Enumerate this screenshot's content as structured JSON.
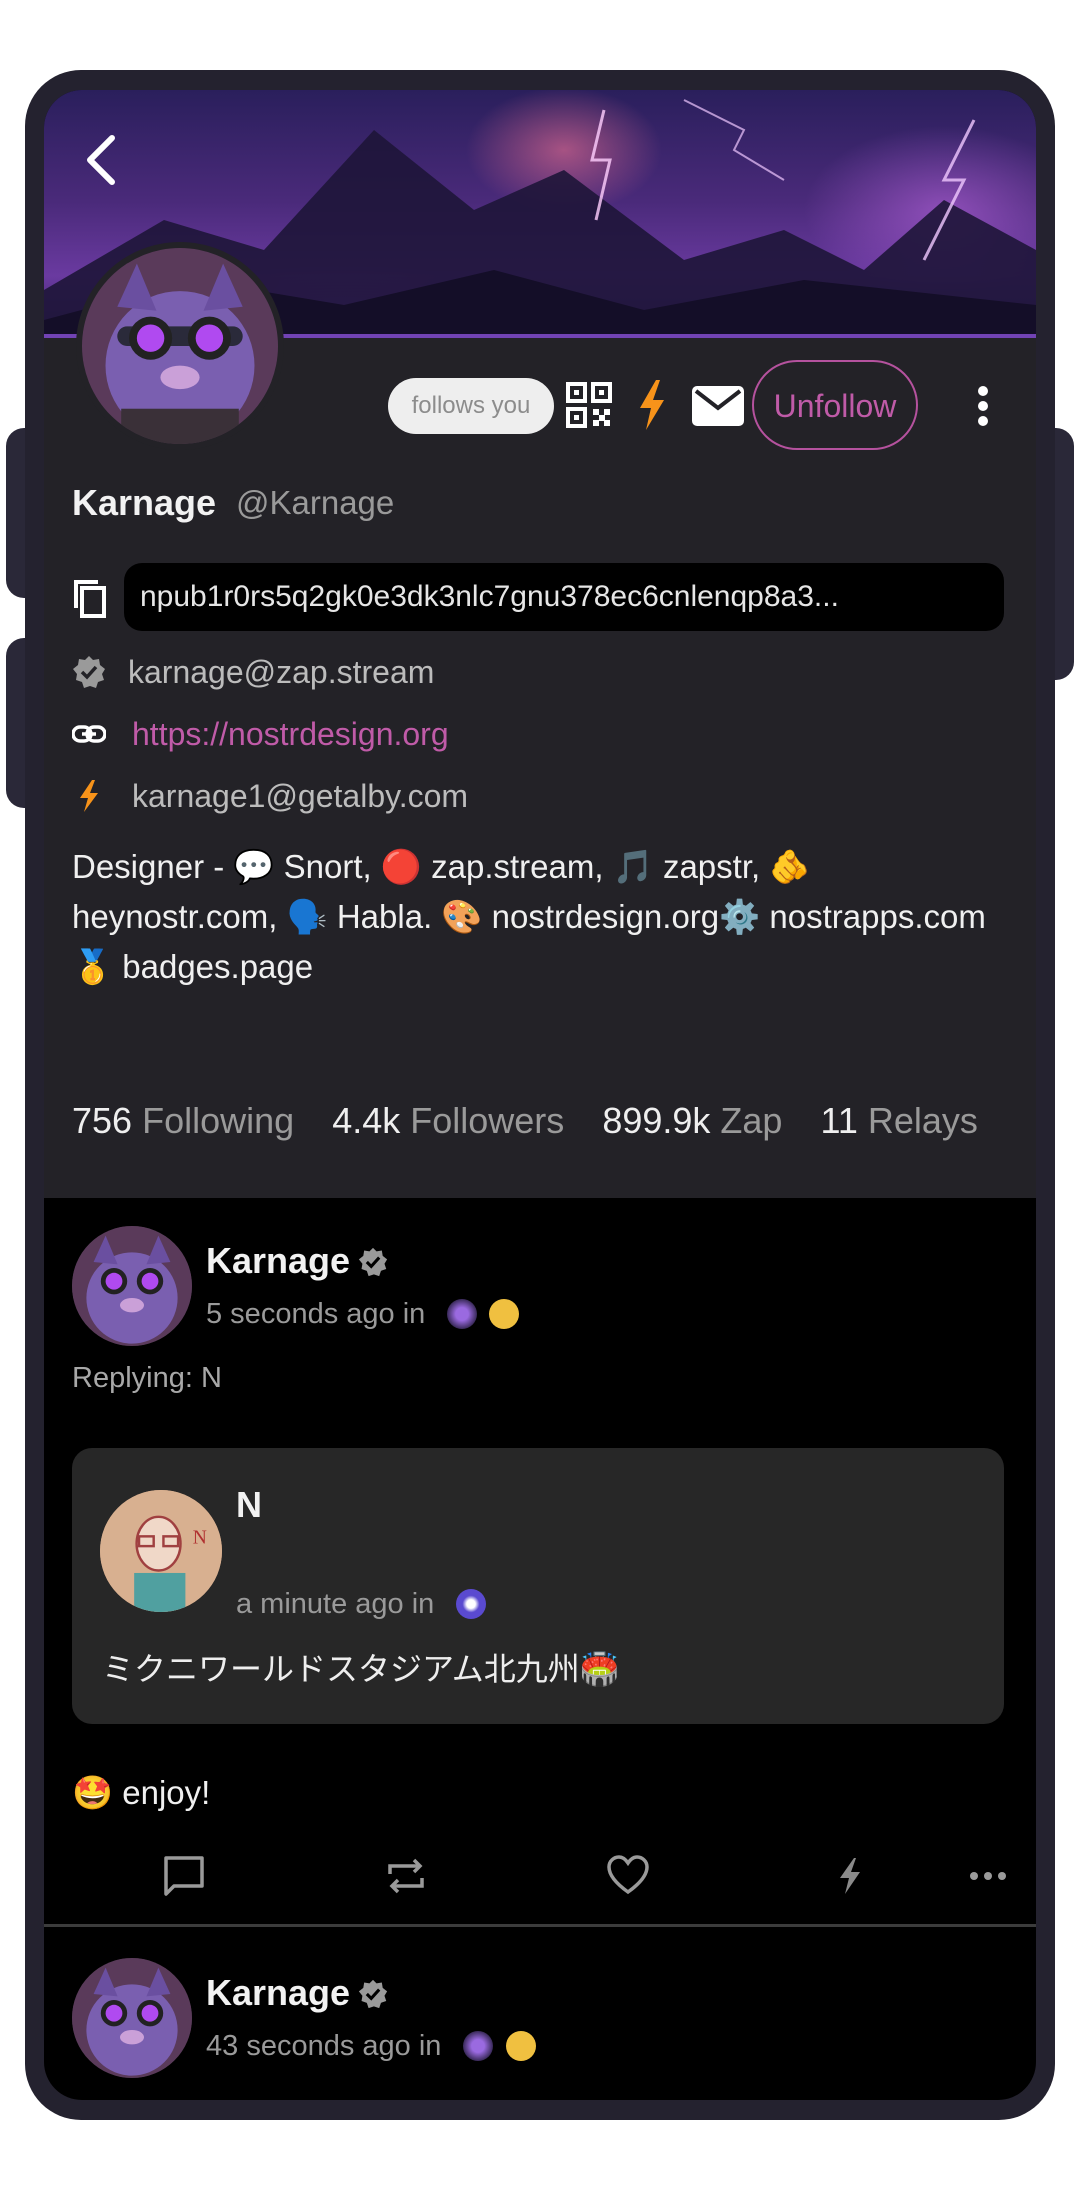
{
  "profile": {
    "name": "Karnage",
    "handle": "@Karnage",
    "follows_you": "follows you",
    "unfollow_label": "Unfollow",
    "npub": "npub1r0rs5q2gk0e3dk3nlc7gnu378ec6cnlenqp8a3...",
    "nip05": "karnage@zap.stream",
    "website": "https://nostrdesign.org",
    "lightning": "karnage1@getalby.com",
    "bio": "Designer - 💬 Snort, 🔴 zap.stream, 🎵 zapstr, 🫵 heynostr.com, 🗣️ Habla. 🎨 nostrdesign.org⚙️ nostrapps.com 🥇 badges.page",
    "stats": [
      {
        "value": "756",
        "label": "Following"
      },
      {
        "value": "4.4k",
        "label": "Followers"
      },
      {
        "value": "899.9k",
        "label": "Zap"
      },
      {
        "value": "11",
        "label": "Relays"
      }
    ]
  },
  "notes": [
    {
      "author": "Karnage",
      "time": "5 seconds ago in",
      "replying": "Replying: N",
      "quote": {
        "author": "N",
        "time": "a minute ago in",
        "text": "ミクニワールドスタジアム北九州🏟️"
      },
      "text": "🤩 enjoy!"
    },
    {
      "author": "Karnage",
      "time": "43 seconds ago in"
    }
  ],
  "icons": {
    "back": "chevron-left-icon",
    "qr": "qr-code-icon",
    "zap": "lightning-bolt-icon",
    "message": "envelope-icon",
    "more": "more-vertical-icon",
    "copy": "copy-icon",
    "verified": "verified-badge-icon",
    "link": "link-icon",
    "reply": "comment-icon",
    "repost": "repost-icon",
    "like": "heart-icon",
    "more_horizontal": "more-horizontal-icon"
  },
  "colors": {
    "accent": "#c05ba8",
    "zap": "#f7931a",
    "background": "#000000",
    "card": "#232227"
  }
}
